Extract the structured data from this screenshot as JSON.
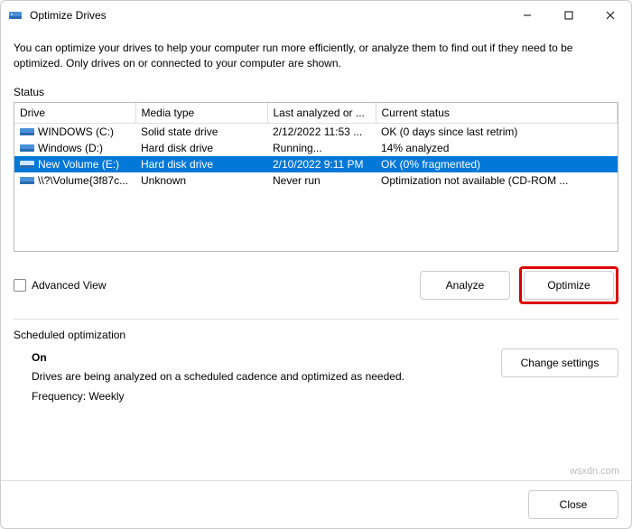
{
  "window": {
    "title": "Optimize Drives"
  },
  "description": "You can optimize your drives to help your computer run more efficiently, or analyze them to find out if they need to be optimized. Only drives on or connected to your computer are shown.",
  "status_label": "Status",
  "columns": {
    "drive": "Drive",
    "media": "Media type",
    "analyzed": "Last analyzed or ...",
    "status": "Current status"
  },
  "rows": [
    {
      "drive": "WINDOWS (C:)",
      "media": "Solid state drive",
      "analyzed": "2/12/2022 11:53 ...",
      "status": "OK (0 days since last retrim)",
      "selected": false
    },
    {
      "drive": "Windows (D:)",
      "media": "Hard disk drive",
      "analyzed": "Running...",
      "status": "14% analyzed",
      "selected": false
    },
    {
      "drive": "New Volume (E:)",
      "media": "Hard disk drive",
      "analyzed": "2/10/2022 9:11 PM",
      "status": "OK (0% fragmented)",
      "selected": true
    },
    {
      "drive": "\\\\?\\Volume{3f87c...",
      "media": "Unknown",
      "analyzed": "Never run",
      "status": "Optimization not available (CD-ROM ...",
      "selected": false
    }
  ],
  "advanced_view_label": "Advanced View",
  "buttons": {
    "analyze": "Analyze",
    "optimize": "Optimize",
    "change_settings": "Change settings",
    "close": "Close"
  },
  "scheduled": {
    "heading": "Scheduled optimization",
    "state": "On",
    "desc": "Drives are being analyzed on a scheduled cadence and optimized as needed.",
    "freq": "Frequency: Weekly"
  },
  "watermark": "wsxdn.com"
}
